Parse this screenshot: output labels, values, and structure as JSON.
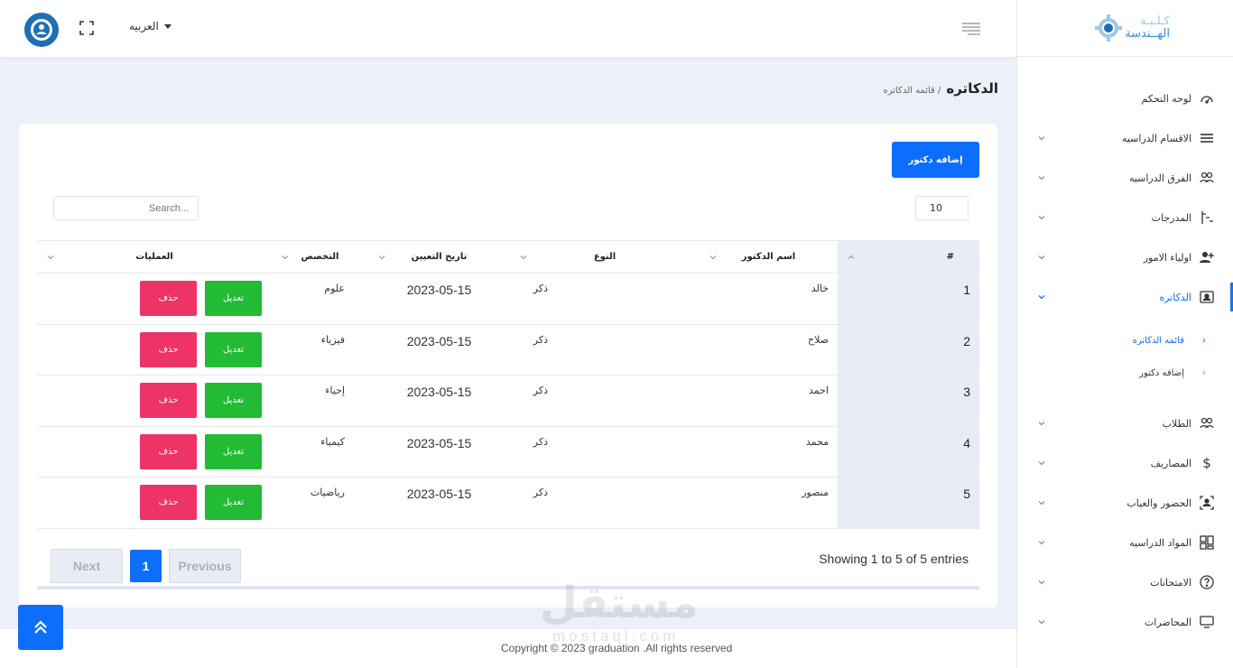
{
  "header": {
    "language": "العربيه"
  },
  "logo": {
    "line1": "كـلـيـة",
    "line2": "الهــندسة"
  },
  "sidebar": {
    "items": [
      {
        "label": "لوحه التحكم",
        "icon": "dashboard-icon",
        "chevron": false
      },
      {
        "label": "الاقسام الدراسيه",
        "icon": "list-icon",
        "chevron": true
      },
      {
        "label": "الفرق الدراسيه",
        "icon": "users-icon",
        "chevron": true
      },
      {
        "label": "المدرجات",
        "icon": "hierarchy-icon",
        "chevron": true
      },
      {
        "label": "اولياء الامور",
        "icon": "user-plus-icon",
        "chevron": true
      },
      {
        "label": "الدكاتره",
        "icon": "id-card-icon",
        "chevron": true,
        "active": true
      }
    ],
    "subitems": [
      {
        "label": "قائمه الدكاتره",
        "active": true
      },
      {
        "label": "إضافه دكتور",
        "active": false
      }
    ],
    "items_after": [
      {
        "label": "الطلاب",
        "icon": "users-icon"
      },
      {
        "label": "المصاريف",
        "icon": "dollar-icon"
      },
      {
        "label": "الحضور والغياب",
        "icon": "attendance-icon"
      },
      {
        "label": "المواد الدراسيه",
        "icon": "grid-icon"
      },
      {
        "label": "الامتحانات",
        "icon": "question-icon"
      },
      {
        "label": "المحاضرات",
        "icon": "monitor-icon"
      }
    ]
  },
  "page": {
    "title": "الدكاتره",
    "breadcrumb": "/ قائمه الدكاتره"
  },
  "table_controls": {
    "add_button": "إضافه دكتور",
    "page_length": "10",
    "search_placeholder": "Search..."
  },
  "table": {
    "columns": [
      "#",
      "اسم الدكتور",
      "النوع",
      "تاريخ التعيين",
      "التخصص",
      "العمليات"
    ],
    "rows": [
      {
        "idx": "1",
        "name": "خالد",
        "gender": "ذكر",
        "date": "2023-05-15",
        "spec": "علوم"
      },
      {
        "idx": "2",
        "name": "صلاح",
        "gender": "ذكر",
        "date": "2023-05-15",
        "spec": "فيزياء"
      },
      {
        "idx": "3",
        "name": "احمد",
        "gender": "ذكر",
        "date": "2023-05-15",
        "spec": "إحياء"
      },
      {
        "idx": "4",
        "name": "محمد",
        "gender": "ذكر",
        "date": "2023-05-15",
        "spec": "كيمياء"
      },
      {
        "idx": "5",
        "name": "منصور",
        "gender": "ذكر",
        "date": "2023-05-15",
        "spec": "رياضيات"
      }
    ],
    "edit_label": "تعديل",
    "delete_label": "حذف"
  },
  "pagination": {
    "info": "Showing 1 to 5 of 5 entries",
    "next": "Next",
    "current": "1",
    "previous": "Previous"
  },
  "footer": {
    "copyright": "Copyright © 2023 graduation .All rights reserved"
  },
  "watermark": {
    "ar": "مستقل",
    "en": "mostaql.com"
  },
  "colors": {
    "primary": "#0d6efd",
    "edit": "#22bb33",
    "delete": "#ee3366"
  }
}
